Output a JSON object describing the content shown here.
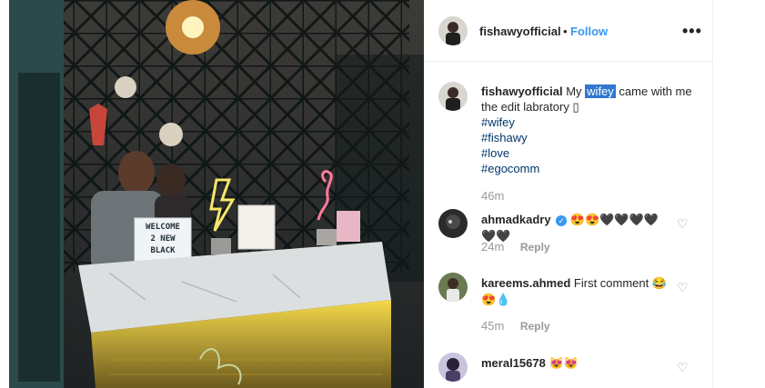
{
  "post": {
    "username": "fishawyofficial",
    "separator": "•",
    "follow_label": "Follow",
    "more_icon": "more-options-icon"
  },
  "photo": {
    "sign_lines": [
      "WELCOME",
      "2 NEW",
      "BLACK"
    ],
    "description_icon": "photo"
  },
  "caption": {
    "username": "fishawyofficial",
    "text_before": "My",
    "highlight": "wifey",
    "text_after": "came with me the edit labratory",
    "trailing_glyph": "▯",
    "hashtags": [
      "#wifey",
      "#fishawy",
      "#love",
      "#egocomm"
    ],
    "time": "46m"
  },
  "comments": [
    {
      "username": "ahmadkadry",
      "verified": true,
      "text": "😍😍🖤🖤🖤🖤🖤🖤",
      "time": "24m",
      "reply_label": "Reply"
    },
    {
      "username": "kareems.ahmed",
      "verified": false,
      "text": "First comment 😂 😍💧",
      "time": "45m",
      "reply_label": "Reply"
    },
    {
      "username": "meral15678",
      "verified": false,
      "text": "😻😻",
      "time": "",
      "reply_label": ""
    }
  ],
  "colors": {
    "link": "#003569",
    "follow": "#3897f0",
    "muted": "#999999",
    "highlight": "#2f77d1"
  }
}
